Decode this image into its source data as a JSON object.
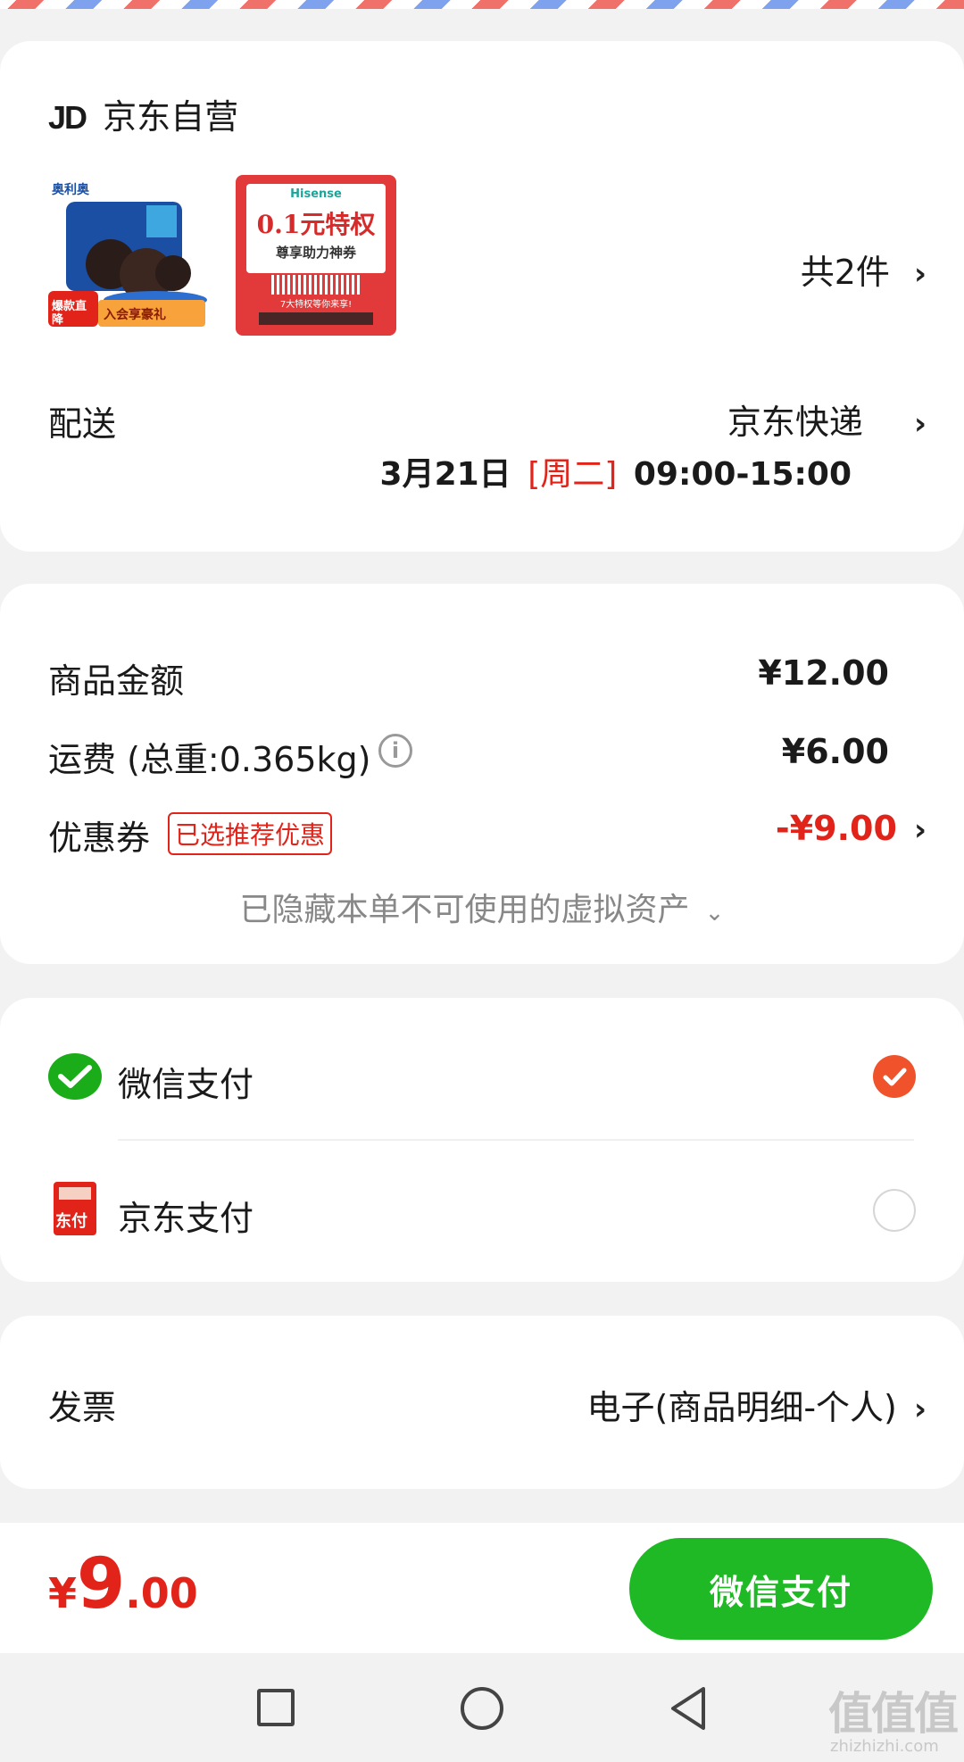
{
  "shop": {
    "logo_text": "JD",
    "name": "京东自营"
  },
  "products": {
    "item1": {
      "brand_label": "奥利奥",
      "badge_left": "爆款直降",
      "badge_right": "入会享豪礼"
    },
    "item2": {
      "brand": "Hisense",
      "headline": "0.1元特权",
      "subline": "尊享助力神券",
      "footer": "7大特权等你来享!"
    },
    "count_label": "共2件"
  },
  "delivery": {
    "label": "配送",
    "method": "京东快递",
    "date": "3月21日",
    "weekday": "[周二]",
    "time": "09:00-15:00"
  },
  "pricing": {
    "goods_label": "商品金额",
    "goods_value": "¥12.00",
    "shipping_label": "运费 (总重:0.365kg)",
    "shipping_value": "¥6.00",
    "coupon_label": "优惠券",
    "coupon_tag": "已选推荐优惠",
    "coupon_value": "-¥9.00",
    "hidden_assets_text": "已隐藏本单不可使用的虚拟资产"
  },
  "payment": {
    "options": [
      {
        "label": "微信支付",
        "selected": true
      },
      {
        "label": "京东支付",
        "selected": false
      }
    ],
    "jd_icon_text": "东付"
  },
  "invoice": {
    "label": "发票",
    "value": "电子(商品明细-个人)"
  },
  "bottom_bar": {
    "currency": "¥",
    "total_int": "9",
    "total_dec": ".00",
    "pay_button": "微信支付"
  },
  "watermark": {
    "text": "值值值",
    "subtext": "zhizhizhi.com"
  },
  "colors": {
    "accent_red": "#e2231a",
    "wechat_green": "#1fb925",
    "radio_orange": "#f0532b"
  }
}
